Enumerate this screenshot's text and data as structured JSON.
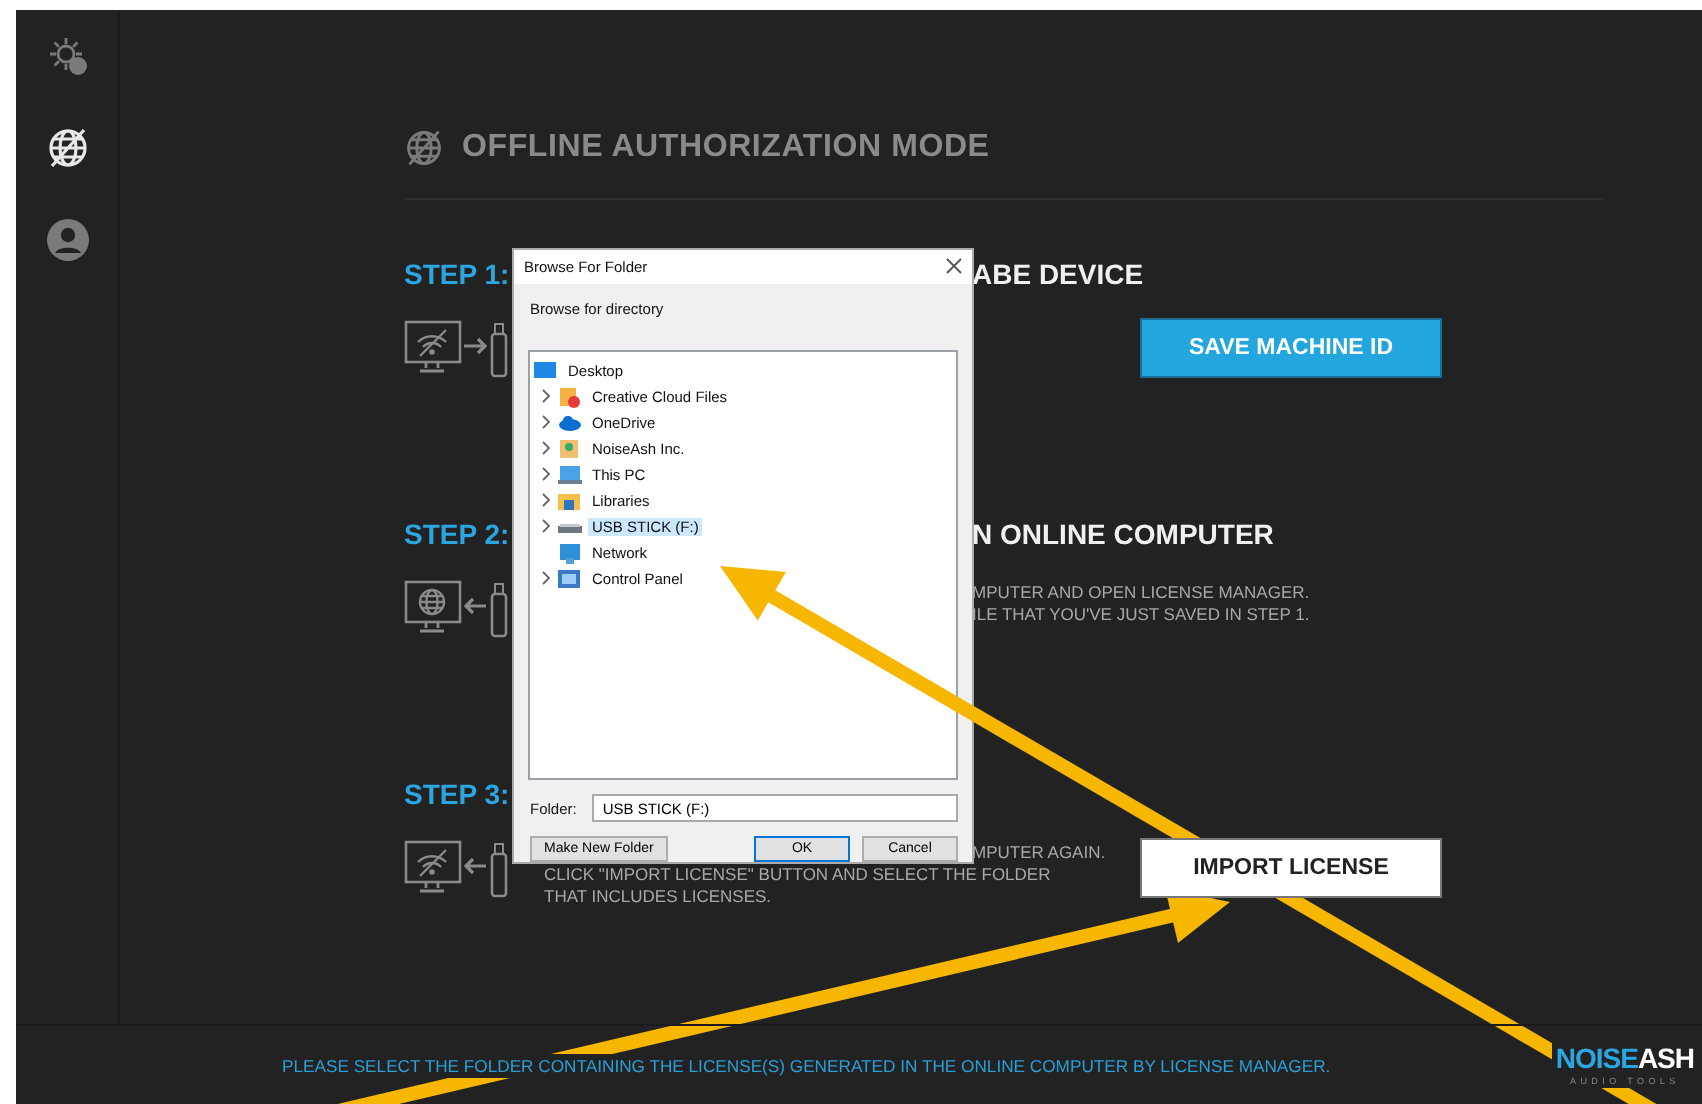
{
  "sidebar": {
    "items": [
      {
        "kind": "settings",
        "selected": false
      },
      {
        "kind": "offline",
        "selected": true
      },
      {
        "kind": "account",
        "selected": false
      }
    ]
  },
  "page": {
    "title": "OFFLINE AUTHORIZATION MODE"
  },
  "steps": [
    {
      "label": "STEP 1:",
      "title": "ABE DEVICE",
      "online": false,
      "sending": true,
      "button": {
        "label": "SAVE MACHINE ID",
        "kind": "primary"
      }
    },
    {
      "label": "STEP 2:",
      "title": "N ONLINE COMPUTER",
      "online": true,
      "sending": false,
      "description": [
        "MPUTER AND OPEN LICENSE MANAGER.",
        "ILE THAT YOU'VE JUST SAVED IN STEP 1."
      ]
    },
    {
      "label": "STEP 3:",
      "online": false,
      "sending": false,
      "description": [
        "MPUTER AGAIN.",
        "CLICK \"IMPORT LICENSE\" BUTTON AND SELECT THE FOLDER",
        "THAT INCLUDES LICENSES."
      ],
      "button": {
        "label": "IMPORT LICENSE",
        "kind": "secondary"
      }
    }
  ],
  "footer": {
    "message": "PLEASE SELECT THE FOLDER CONTAINING THE LICENSE(S) GENERATED IN THE ONLINE COMPUTER BY LICENSE MANAGER.",
    "logo": {
      "part_1": "NOISE",
      "part_2": "ASH",
      "tagline": "AUDIO TOOLS"
    }
  },
  "dialog": {
    "title": "Browse For Folder",
    "prompt": "Browse for directory",
    "tree": [
      {
        "label": "Desktop",
        "kind": "desktop",
        "selected": false,
        "expandable": false,
        "children": [
          {
            "label": "Creative Cloud Files",
            "kind": "cloudfolder",
            "selected": false,
            "expandable": true
          },
          {
            "label": "OneDrive",
            "kind": "cloud",
            "selected": false,
            "expandable": true
          },
          {
            "label": "NoiseAsh Inc.",
            "kind": "user",
            "selected": false,
            "expandable": true
          },
          {
            "label": "This PC",
            "kind": "pc",
            "selected": false,
            "expandable": true
          },
          {
            "label": "Libraries",
            "kind": "folder",
            "selected": false,
            "expandable": true
          },
          {
            "label": "USB STICK (F:)",
            "kind": "drive",
            "selected": true,
            "expandable": true
          },
          {
            "label": "Network",
            "kind": "network",
            "selected": false,
            "expandable": false
          },
          {
            "label": "Control Panel",
            "kind": "panel",
            "selected": false,
            "expandable": true
          }
        ]
      }
    ],
    "folder_label": "Folder:",
    "folder_value": "USB STICK (F:)",
    "buttons": [
      {
        "label": "Make New Folder",
        "default": false
      },
      {
        "label": "OK",
        "default": true
      },
      {
        "label": "Cancel",
        "default": false
      }
    ]
  }
}
